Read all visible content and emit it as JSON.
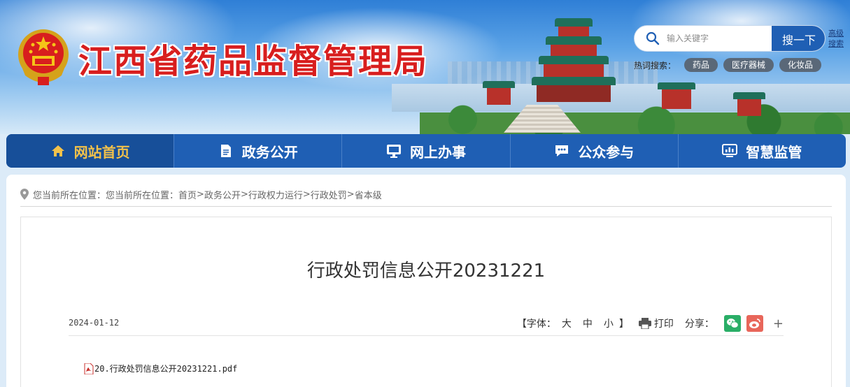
{
  "header": {
    "site_title": "江西省药品监督管理局",
    "search": {
      "placeholder": "输入关键字",
      "button_label": "搜一下",
      "advanced_label": "高级搜索"
    },
    "hot_search": {
      "label": "热词搜索：",
      "tags": [
        "药品",
        "医疗器械",
        "化妆品"
      ]
    }
  },
  "nav": {
    "items": [
      {
        "label": "网站首页",
        "icon": "home-icon",
        "active": true
      },
      {
        "label": "政务公开",
        "icon": "document-icon",
        "active": false
      },
      {
        "label": "网上办事",
        "icon": "monitor-icon",
        "active": false
      },
      {
        "label": "公众参与",
        "icon": "chat-icon",
        "active": false
      },
      {
        "label": "智慧监管",
        "icon": "dashboard-icon",
        "active": false
      }
    ]
  },
  "breadcrumb": {
    "prefix": "您当前所在位置：您当前所在位置：",
    "items": [
      "首页",
      "政务公开",
      "行政权力运行",
      "行政处罚",
      "省本级"
    ],
    "separator": ">"
  },
  "article": {
    "title": "行政处罚信息公开20231221",
    "date": "2024-01-12",
    "font_size": {
      "open": "【字体：",
      "large": "大",
      "medium": "中",
      "small": "小",
      "close": "】"
    },
    "print_label": "打印",
    "share_label": "分享：",
    "share_more": "+",
    "attachment": "20.行政处罚信息公开20231221.pdf"
  },
  "colors": {
    "nav_bg": "#1f5fb4",
    "nav_active_text": "#f2c14a",
    "title_red": "#d81e1e",
    "wechat": "#2aae67",
    "weibo": "#e8665a"
  }
}
